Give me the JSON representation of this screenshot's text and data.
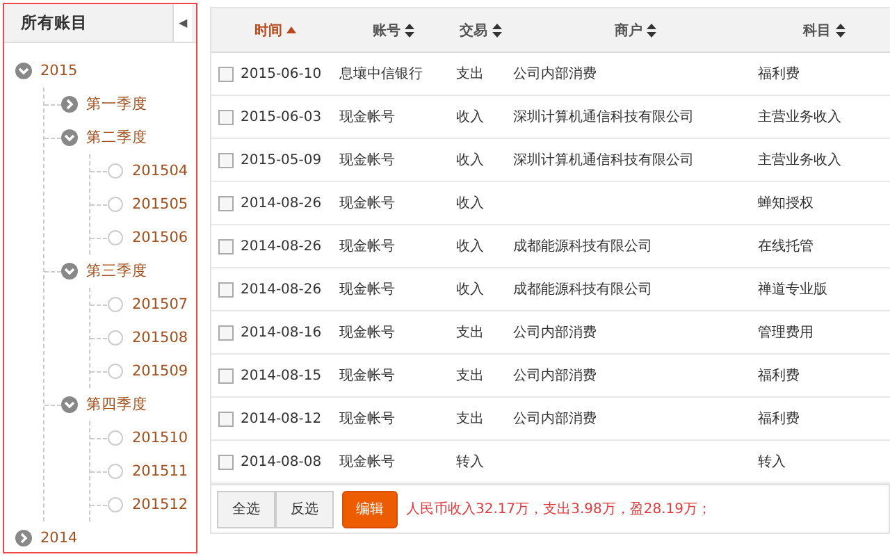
{
  "sidebar": {
    "title": "所有账目",
    "collapse_icon": "◀",
    "tree": [
      {
        "label": "2015",
        "expanded": true,
        "children": [
          {
            "label": "第一季度",
            "expanded": false
          },
          {
            "label": "第二季度",
            "expanded": true,
            "children": [
              {
                "label": "201504"
              },
              {
                "label": "201505"
              },
              {
                "label": "201506"
              }
            ]
          },
          {
            "label": "第三季度",
            "expanded": true,
            "children": [
              {
                "label": "201507"
              },
              {
                "label": "201508"
              },
              {
                "label": "201509"
              }
            ]
          },
          {
            "label": "第四季度",
            "expanded": true,
            "children": [
              {
                "label": "201510"
              },
              {
                "label": "201511"
              },
              {
                "label": "201512"
              }
            ]
          }
        ]
      },
      {
        "label": "2014",
        "expanded": false
      }
    ]
  },
  "table": {
    "columns": [
      {
        "label": "时间",
        "selected": true
      },
      {
        "label": "账号",
        "selected": false
      },
      {
        "label": "交易",
        "selected": false
      },
      {
        "label": "商户",
        "selected": false
      },
      {
        "label": "科目",
        "selected": false
      }
    ],
    "rows": [
      {
        "checked": false,
        "cells": [
          "2015-06-10",
          "息壤中信银行",
          "支出",
          "公司内部消费",
          "福利费"
        ]
      },
      {
        "checked": false,
        "cells": [
          "2015-06-03",
          "现金帐号",
          "收入",
          "深圳计算机通信科技有限公司",
          "主营业务收入"
        ]
      },
      {
        "checked": false,
        "cells": [
          "2015-05-09",
          "现金帐号",
          "收入",
          "深圳计算机通信科技有限公司",
          "主营业务收入"
        ]
      },
      {
        "checked": false,
        "cells": [
          "2014-08-26",
          "现金帐号",
          "收入",
          "",
          "蝉知授权"
        ]
      },
      {
        "checked": false,
        "cells": [
          "2014-08-26",
          "现金帐号",
          "收入",
          "成都能源科技有限公司",
          "在线托管"
        ]
      },
      {
        "checked": false,
        "cells": [
          "2014-08-26",
          "现金帐号",
          "收入",
          "成都能源科技有限公司",
          "禅道专业版"
        ]
      },
      {
        "checked": false,
        "cells": [
          "2014-08-16",
          "现金帐号",
          "支出",
          "公司内部消费",
          "管理费用"
        ]
      },
      {
        "checked": false,
        "cells": [
          "2014-08-15",
          "现金帐号",
          "支出",
          "公司内部消费",
          "福利费"
        ]
      },
      {
        "checked": false,
        "cells": [
          "2014-08-12",
          "现金帐号",
          "支出",
          "公司内部消费",
          "福利费"
        ]
      },
      {
        "checked": false,
        "cells": [
          "2014-08-08",
          "现金帐号",
          "转入",
          "",
          "转入"
        ]
      }
    ]
  },
  "footer": {
    "buttons": [
      "全选",
      "反选"
    ],
    "primary_button": "编辑",
    "summary": "人民币收入32.17万，支出3.98万，盈28.19万；"
  }
}
